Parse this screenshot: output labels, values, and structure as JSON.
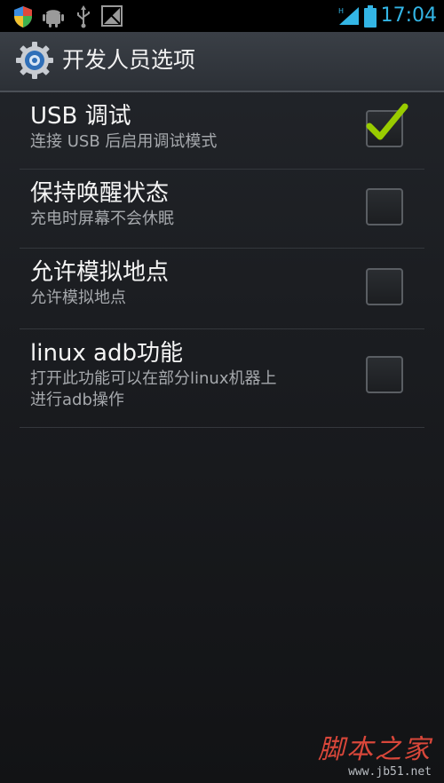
{
  "status_bar": {
    "time": "17:04",
    "left_icons": [
      "shield-icon",
      "android-icon",
      "usb-icon",
      "no-signal-icon"
    ],
    "right_icons": [
      "signal-icon",
      "battery-icon"
    ],
    "accent_color": "#33b5e5"
  },
  "action_bar": {
    "icon": "settings-gear-icon",
    "title": "开发人员选项"
  },
  "preferences": [
    {
      "title": "USB 调试",
      "summary": "连接 USB 后启用调试模式",
      "checked": true
    },
    {
      "title": "保持唤醒状态",
      "summary": "充电时屏幕不会休眠",
      "checked": false
    },
    {
      "title": "允许模拟地点",
      "summary": "允许模拟地点",
      "checked": false
    },
    {
      "title": "linux adb功能",
      "summary_line1": "打开此功能可以在部分linux机器上",
      "summary_line2": "进行adb操作",
      "checked": false
    }
  ],
  "watermark": {
    "text": "脚本之家",
    "url": "www.jb51.net"
  },
  "check_color": "#99cc00"
}
